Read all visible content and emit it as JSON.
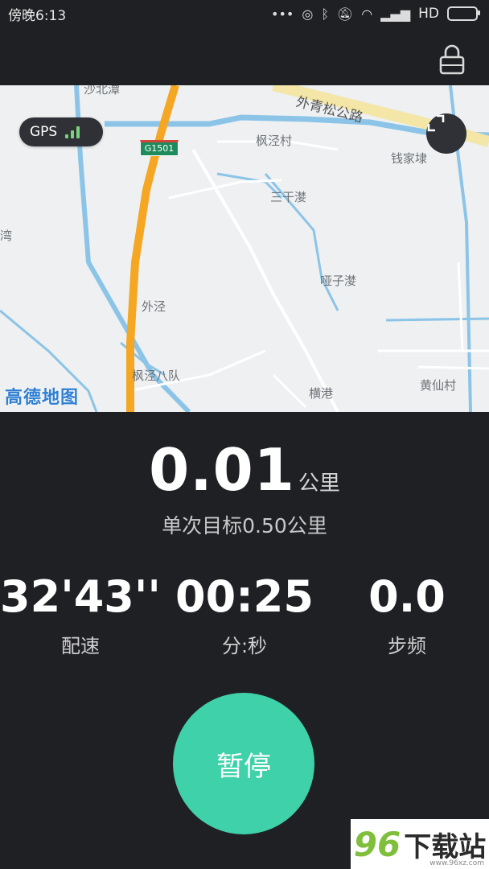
{
  "status_bar": {
    "carrier_time": "傍晚6:13",
    "network": "HD"
  },
  "map": {
    "gps_label": "GPS",
    "road_name": "外青松公路",
    "road_badge": "G1501",
    "places": [
      "枫泾村",
      "钱家埭",
      "三干漤",
      "哑子漤",
      "外泾",
      "枫泾八队",
      "横港",
      "黄仙村",
      "沙北潭",
      "湾"
    ],
    "logo": "高德地图"
  },
  "stats": {
    "distance_value": "0.01",
    "distance_unit": "公里",
    "goal_text": "单次目标0.50公里",
    "pace_value": "32'43''",
    "pace_label": "配速",
    "duration_value": "00:25",
    "duration_label": "分:秒",
    "cadence_value": "0.0",
    "cadence_label": "步频"
  },
  "controls": {
    "pause_label": "暂停"
  },
  "watermark": {
    "number": "96",
    "text": "下载站",
    "url": "www.96xz.com"
  },
  "colors": {
    "background": "#1f2024",
    "accent": "#3fd1a9",
    "road_orange": "#f5a623",
    "water": "#8cc4e8"
  }
}
